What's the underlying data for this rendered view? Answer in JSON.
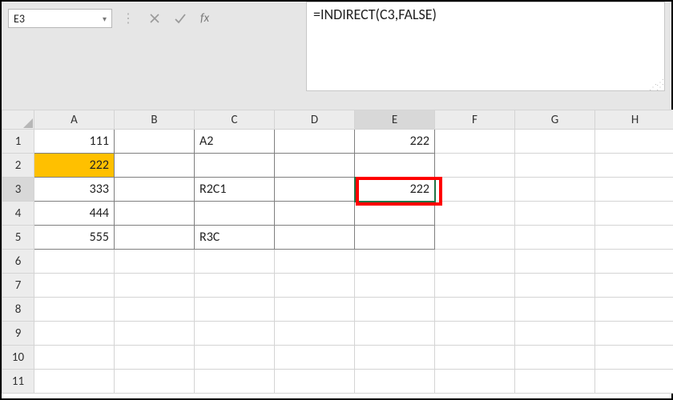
{
  "name_box": "E3",
  "formula_bar": "=INDIRECT(C3,FALSE)",
  "fx_label": "fx",
  "columns": [
    "A",
    "B",
    "C",
    "D",
    "E",
    "F",
    "G",
    "H"
  ],
  "rows": [
    "1",
    "2",
    "3",
    "4",
    "5",
    "6",
    "7",
    "8",
    "9",
    "10",
    "11"
  ],
  "selected_cell": "E3",
  "active_col_idx": 4,
  "active_row_idx": 2,
  "highlight": {
    "A2": "#ffc000"
  },
  "cells": {
    "A1": {
      "v": "111",
      "t": "num"
    },
    "A2": {
      "v": "222",
      "t": "num"
    },
    "A3": {
      "v": "333",
      "t": "num"
    },
    "A4": {
      "v": "444",
      "t": "num"
    },
    "A5": {
      "v": "555",
      "t": "num"
    },
    "C1": {
      "v": "A2",
      "t": "txt"
    },
    "C3": {
      "v": "R2C1",
      "t": "txt"
    },
    "C5": {
      "v": "R3C",
      "t": "txt"
    },
    "E1": {
      "v": "222",
      "t": "num"
    },
    "E3": {
      "v": "222",
      "t": "num"
    }
  },
  "data_range": {
    "rows": [
      0,
      4
    ],
    "cols": [
      0,
      4
    ]
  }
}
